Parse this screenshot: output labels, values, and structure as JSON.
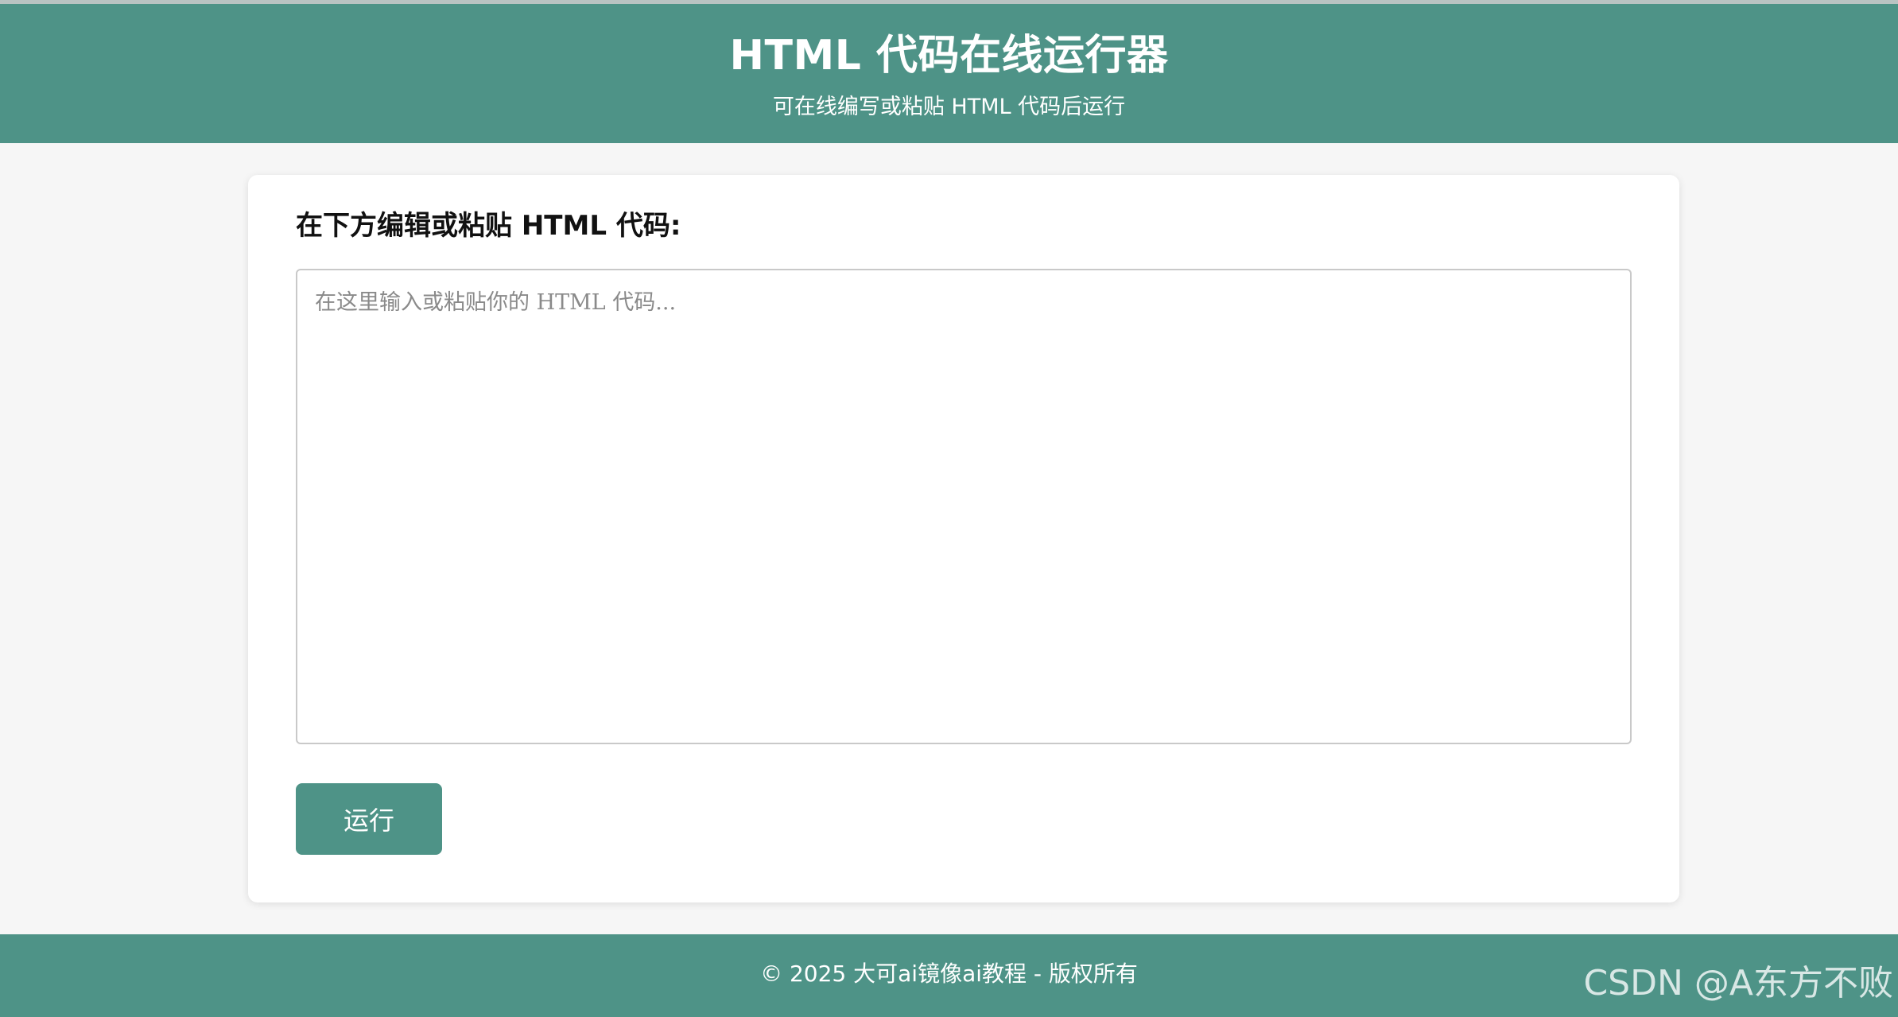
{
  "header": {
    "title": "HTML 代码在线运行器",
    "subtitle": "可在线编写或粘贴 HTML 代码后运行"
  },
  "editor_section": {
    "label": "在下方编辑或粘贴 HTML 代码:",
    "textarea_value": "",
    "textarea_placeholder": "在这里输入或粘贴你的 HTML 代码...",
    "run_button_label": "运行"
  },
  "footer": {
    "text": "© 2025 大可ai镜像ai教程 - 版权所有"
  },
  "watermark": "CSDN @A东方不败",
  "colors": {
    "accent": "#4e9387",
    "page_background": "#f6f6f6",
    "card_background": "#ffffff"
  }
}
